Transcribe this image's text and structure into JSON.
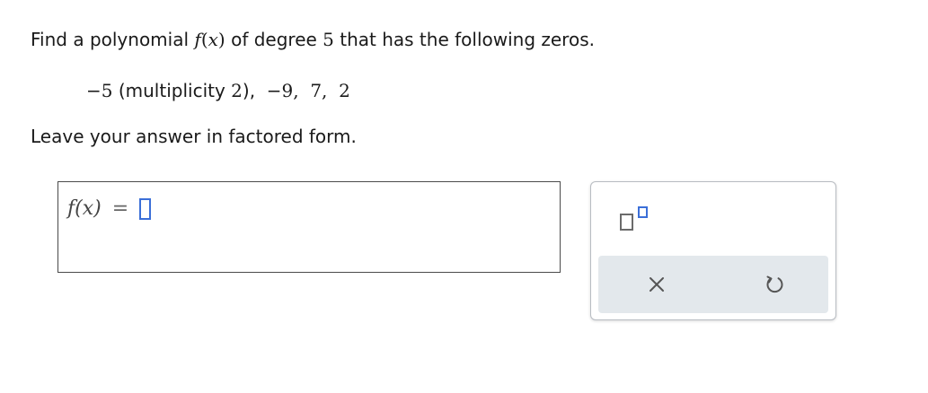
{
  "question": {
    "line1_prefix": "Find a polynomial ",
    "line1_func": "f",
    "line1_paren_open": "(",
    "line1_var": "x",
    "line1_paren_close": ")",
    "line1_middle": " of degree ",
    "degree": "5",
    "line1_suffix": " that has the following zeros.",
    "zeros_first": "−5",
    "zeros_multiplicity": " (multiplicity ",
    "multiplicity_value": "2",
    "zeros_multiplicity_close": "),",
    "zeros_rest": "  −9,  7,  2",
    "line2": "Leave your answer in factored form."
  },
  "answer": {
    "lhs": "f(x)",
    "equals": "=",
    "value": ""
  },
  "tools": {
    "superscript_icon": "superscript-template-icon",
    "clear_icon": "close-x-icon",
    "undo_icon": "undo-icon",
    "accent_color": "#3b6fd8",
    "icon_color": "#555555",
    "action_bar_color": "#e3e8ec"
  }
}
